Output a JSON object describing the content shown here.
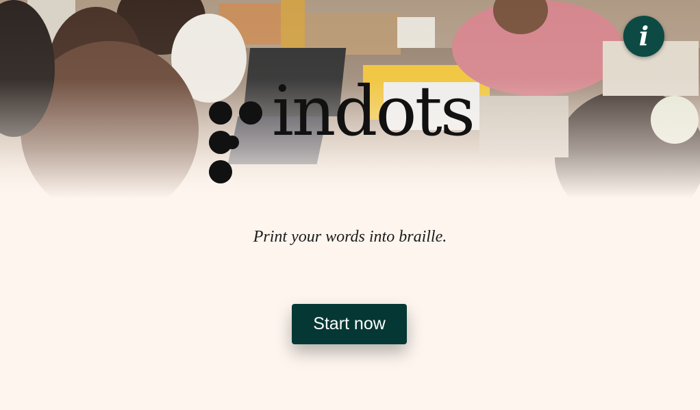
{
  "brand": {
    "name": "indots",
    "tagline": "Print your words into braille."
  },
  "actions": {
    "start_label": "Start now",
    "info_label": "i"
  },
  "colors": {
    "background": "#fdf5ee",
    "button": "#053834",
    "info_button": "#0d4a44"
  },
  "hero": {
    "description_icon": "workshop-photo"
  }
}
